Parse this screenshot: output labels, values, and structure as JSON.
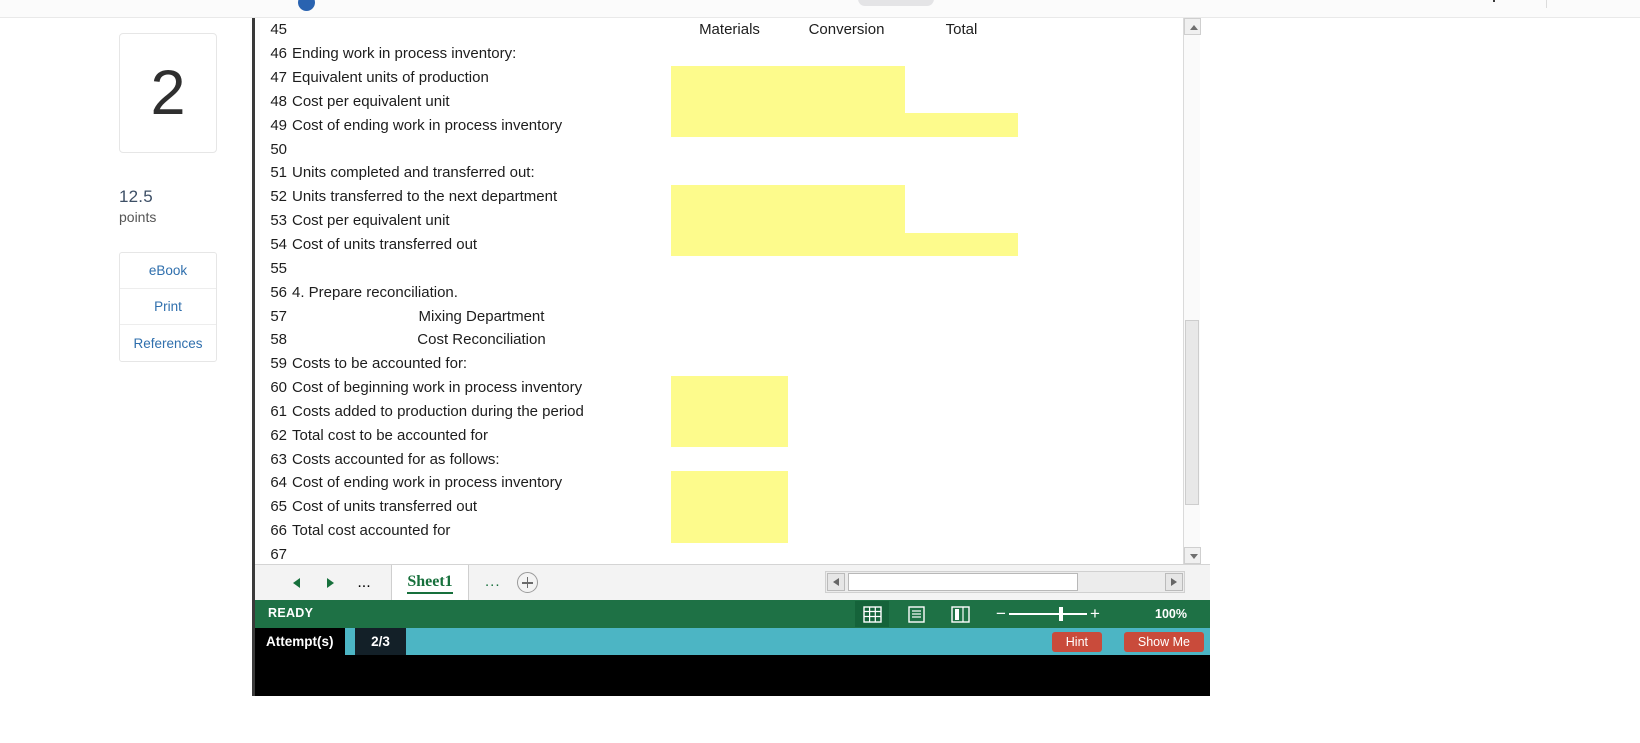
{
  "question": {
    "number": "2",
    "points_value": "12.5",
    "points_label": "points",
    "links": [
      {
        "label": "eBook"
      },
      {
        "label": "Print"
      },
      {
        "label": "References"
      }
    ]
  },
  "spreadsheet": {
    "column_headers": [
      "",
      "Materials",
      "Conversion",
      "Total",
      "",
      ""
    ],
    "rows": [
      {
        "num": "45",
        "a": "",
        "indent": false,
        "header_row": true
      },
      {
        "num": "46",
        "a": "Ending work in process inventory:",
        "indent": false
      },
      {
        "num": "47",
        "a": "Equivalent units of production",
        "indent": true
      },
      {
        "num": "48",
        "a": "Cost per equivalent unit",
        "indent": true
      },
      {
        "num": "49",
        "a": "Cost of ending work in process inventory",
        "indent": true
      },
      {
        "num": "50",
        "a": "",
        "indent": false
      },
      {
        "num": "51",
        "a": "Units completed and transferred out:",
        "indent": false
      },
      {
        "num": "52",
        "a": "Units transferred to the next department",
        "indent": true
      },
      {
        "num": "53",
        "a": "Cost per equivalent unit",
        "indent": true
      },
      {
        "num": "54",
        "a": "Cost of units transferred out",
        "indent": true
      },
      {
        "num": "55",
        "a": "",
        "indent": false
      },
      {
        "num": "56",
        "a": "4. Prepare reconciliation.",
        "indent": false
      },
      {
        "num": "57",
        "a": "Mixing Department",
        "indent": false,
        "center": true
      },
      {
        "num": "58",
        "a": "Cost Reconciliation",
        "indent": false,
        "center": true
      },
      {
        "num": "59",
        "a": "Costs to be accounted for:",
        "indent": false
      },
      {
        "num": "60",
        "a": "Cost of beginning work in process inventory",
        "indent": true
      },
      {
        "num": "61",
        "a": "Costs added to production during the period",
        "indent": true
      },
      {
        "num": "62",
        "a": "Total cost to be accounted for",
        "indent": true
      },
      {
        "num": "63",
        "a": "Costs accounted for as follows:",
        "indent": false
      },
      {
        "num": "64",
        "a": "Cost of ending work in process inventory",
        "indent": true
      },
      {
        "num": "65",
        "a": "Cost of units transferred out",
        "indent": true
      },
      {
        "num": "66",
        "a": "Total cost accounted for",
        "indent": true
      },
      {
        "num": "67",
        "a": "",
        "indent": false
      }
    ],
    "input_cells": {
      "note": "empty yellow input cells",
      "fill_color": "#fdfb8c"
    },
    "tabs": {
      "first_label": "prev-sheet",
      "sheet_name": "Sheet1",
      "ellipsis_left": "...",
      "ellipsis_right": "...",
      "add_label": "+"
    },
    "status_bar": {
      "mode": "READY",
      "zoom_percent": "100%",
      "views": [
        "normal-view",
        "page-layout-view",
        "page-break-view"
      ]
    }
  },
  "attempt_bar": {
    "label": "Attempt(s)",
    "count": "2/3",
    "hint_label": "Hint",
    "show_me_label": "Show Me"
  },
  "colors": {
    "excel_green": "#1e7145",
    "attempt_teal": "#4cb5c4",
    "button_red": "#c94b3b",
    "input_yellow": "#fdfb8c",
    "link_blue": "#2f6fad"
  }
}
